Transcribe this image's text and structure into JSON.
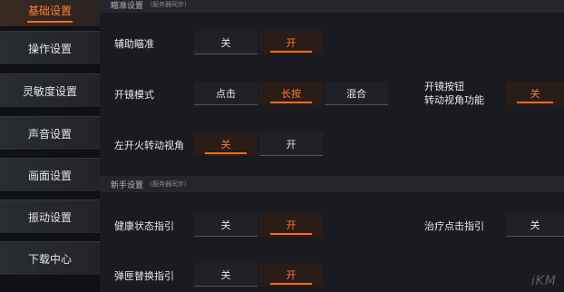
{
  "sidebar": {
    "items": [
      {
        "label": "基础设置",
        "active": true
      },
      {
        "label": "操作设置",
        "active": false
      },
      {
        "label": "灵敏度设置",
        "active": false
      },
      {
        "label": "声音设置",
        "active": false
      },
      {
        "label": "画面设置",
        "active": false
      },
      {
        "label": "振动设置",
        "active": false
      },
      {
        "label": "下载中心",
        "active": false
      }
    ]
  },
  "sections": {
    "aim": {
      "title": "瞄准设置",
      "note": "（服务器同步）"
    },
    "newbie": {
      "title": "新手设置",
      "note": "（服务器同步）"
    }
  },
  "settings": {
    "assist_aim": {
      "label": "辅助瞄准",
      "options": [
        "关",
        "开"
      ],
      "selected": "开"
    },
    "scope_mode": {
      "label": "开镜模式",
      "options": [
        "点击",
        "长按",
        "混合"
      ],
      "selected": "长按"
    },
    "scope_button_turn": {
      "label_line1": "开镜按钮",
      "label_line2": "转动视角功能",
      "options": [
        "关"
      ],
      "selected": "关"
    },
    "left_fire_turn": {
      "label": "左开火转动视角",
      "options": [
        "关",
        "开"
      ],
      "selected": "关"
    },
    "health_guide": {
      "label": "健康状态指引",
      "options": [
        "关",
        "开"
      ],
      "selected": "开"
    },
    "heal_click_guide": {
      "label": "治疗点击指引",
      "options": [
        "关"
      ],
      "selected": null
    },
    "grenade_swap_guide": {
      "label": "弹匣替换指引",
      "options": [
        "关",
        "开"
      ],
      "selected": "开"
    }
  },
  "watermark": {
    "text": "iKM"
  },
  "colors": {
    "accent": "#ff6a22",
    "background": "#1a1b21",
    "sidebar": "#101115"
  }
}
